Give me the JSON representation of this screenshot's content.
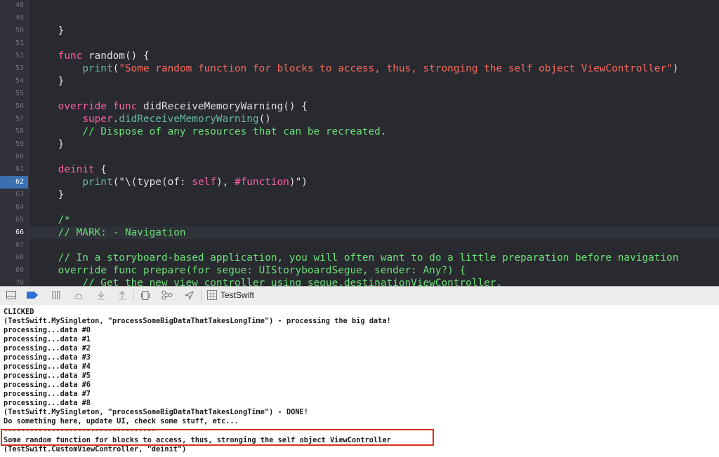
{
  "editor": {
    "lines": [
      {
        "num": "48",
        "tokens": []
      },
      {
        "num": "49",
        "tokens": []
      },
      {
        "num": "50",
        "tokens": [
          {
            "t": "    }",
            "c": ""
          }
        ]
      },
      {
        "num": "51",
        "tokens": []
      },
      {
        "num": "52",
        "tokens": [
          {
            "t": "    ",
            "c": ""
          },
          {
            "t": "func",
            "c": "kw"
          },
          {
            "t": " random() {",
            "c": ""
          }
        ]
      },
      {
        "num": "53",
        "tokens": [
          {
            "t": "        ",
            "c": ""
          },
          {
            "t": "print",
            "c": "fn"
          },
          {
            "t": "(",
            "c": ""
          },
          {
            "t": "\"Some random function for blocks to access, thus, stronging the self object ViewController\"",
            "c": "str"
          },
          {
            "t": ")",
            "c": ""
          }
        ]
      },
      {
        "num": "54",
        "tokens": [
          {
            "t": "    }",
            "c": ""
          }
        ]
      },
      {
        "num": "55",
        "tokens": []
      },
      {
        "num": "56",
        "tokens": [
          {
            "t": "    ",
            "c": ""
          },
          {
            "t": "override",
            "c": "kw"
          },
          {
            "t": " ",
            "c": ""
          },
          {
            "t": "func",
            "c": "kw"
          },
          {
            "t": " didReceiveMemoryWarning() {",
            "c": ""
          }
        ]
      },
      {
        "num": "57",
        "tokens": [
          {
            "t": "        ",
            "c": ""
          },
          {
            "t": "super",
            "c": "kw"
          },
          {
            "t": ".",
            "c": ""
          },
          {
            "t": "didReceiveMemoryWarning",
            "c": "fn"
          },
          {
            "t": "()",
            "c": ""
          }
        ]
      },
      {
        "num": "58",
        "tokens": [
          {
            "t": "        ",
            "c": ""
          },
          {
            "t": "// Dispose of any resources that can be recreated.",
            "c": "cmt"
          }
        ]
      },
      {
        "num": "59",
        "tokens": [
          {
            "t": "    }",
            "c": ""
          }
        ]
      },
      {
        "num": "60",
        "tokens": []
      },
      {
        "num": "61",
        "tokens": [
          {
            "t": "    ",
            "c": ""
          },
          {
            "t": "deinit",
            "c": "kw"
          },
          {
            "t": " {",
            "c": ""
          }
        ]
      },
      {
        "num": "62",
        "current": true,
        "tokens": [
          {
            "t": "        ",
            "c": ""
          },
          {
            "t": "print",
            "c": "fn"
          },
          {
            "t": "(\"\\(",
            "c": ""
          },
          {
            "t": "type",
            "c": ""
          },
          {
            "t": "(of: ",
            "c": ""
          },
          {
            "t": "self",
            "c": "kw"
          },
          {
            "t": "), ",
            "c": ""
          },
          {
            "t": "#function",
            "c": "kw"
          },
          {
            "t": ")\")",
            "c": ""
          }
        ]
      },
      {
        "num": "63",
        "tokens": [
          {
            "t": "    }",
            "c": ""
          }
        ]
      },
      {
        "num": "64",
        "tokens": []
      },
      {
        "num": "65",
        "tokens": [
          {
            "t": "    /*",
            "c": "cmt"
          }
        ]
      },
      {
        "num": "66",
        "current": true,
        "tokens": [
          {
            "t": "    // MARK: - Navigation",
            "c": "cmt"
          }
        ]
      },
      {
        "num": "67",
        "tokens": []
      },
      {
        "num": "68",
        "tokens": [
          {
            "t": "    // In a storyboard-based application, you will often want to do a little preparation before navigation",
            "c": "cmt"
          }
        ]
      },
      {
        "num": "69",
        "tokens": [
          {
            "t": "    override func prepare(for segue: UIStoryboardSegue, sender: Any?) {",
            "c": "cmt"
          }
        ]
      },
      {
        "num": "70",
        "tokens": [
          {
            "t": "        // Get the new view controller using segue.destinationViewController.",
            "c": "cmt"
          }
        ]
      }
    ]
  },
  "toolbar": {
    "target_name": "TestSwift",
    "icons": [
      "hide-debug-area-icon",
      "breakpoints-icon",
      "pause-icon",
      "step-over-icon",
      "step-into-icon",
      "step-out-icon",
      "view-hierarchy-icon",
      "memory-graph-icon",
      "location-icon",
      "scheme-icon"
    ]
  },
  "console": {
    "lines": [
      "CLICKED",
      "(TestSwift.MySingleton, \"processSomeBigDataThatTakesLongTime\") - processing the big data!",
      "processing...data #0",
      "processing...data #1",
      "processing...data #2",
      "processing...data #3",
      "processing...data #4",
      "processing...data #5",
      "processing...data #6",
      "processing...data #7",
      "processing...data #8",
      "(TestSwift.MySingleton, \"processSomeBigDataThatTakesLongTime\") - DONE!",
      "Do something here, update UI, check some stuff, etc...",
      "-----------------------------------",
      "Some random function for blocks to access, thus, stronging the self object ViewController",
      "(TestSwift.CustomViewController, \"deinit\")"
    ]
  },
  "colors": {
    "keyword": "#fc5fa3",
    "string": "#fc6a5d",
    "comment": "#6bdf76",
    "highlight_red": "#d6341f",
    "line_marker": "#3a6fb0"
  }
}
